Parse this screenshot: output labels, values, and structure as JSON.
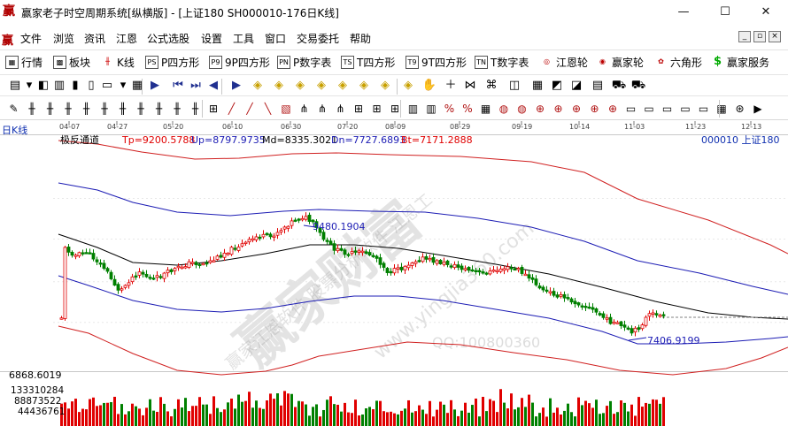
{
  "window": {
    "app_icon": "赢",
    "title": "赢家老子时空周期系统[纵横版] - [上证180  SH000010-176日K线]",
    "minimize": "—",
    "maximize": "☐",
    "close": "✕"
  },
  "menu": {
    "icon": "赢",
    "items": [
      "文件",
      "浏览",
      "资讯",
      "江恩",
      "公式选股",
      "设置",
      "工具",
      "窗口",
      "交易委托",
      "帮助"
    ],
    "mdi": [
      "_",
      "▫",
      "×"
    ]
  },
  "toolbar1": [
    {
      "icon": "grid-icon",
      "glyph": "▦",
      "label": "行情"
    },
    {
      "icon": "blocks-icon",
      "glyph": "▩",
      "label": "板块"
    },
    {
      "icon": "kline-icon",
      "glyph": "╫",
      "label": "K线"
    },
    {
      "icon": "ps-icon",
      "glyph": "PS",
      "label": "P四方形"
    },
    {
      "icon": "ps9-icon",
      "glyph": "P9",
      "label": "9P四方形"
    },
    {
      "icon": "pn-icon",
      "glyph": "PN",
      "label": "P数字表"
    },
    {
      "icon": "ts-icon",
      "glyph": "TS",
      "label": "T四方形"
    },
    {
      "icon": "ts9-icon",
      "glyph": "T9",
      "label": "9T四方形"
    },
    {
      "icon": "tn-icon",
      "glyph": "TN",
      "label": "T数字表"
    },
    {
      "icon": "gann-wheel-icon",
      "glyph": "◎",
      "label": "江恩轮"
    },
    {
      "icon": "winner-wheel-icon",
      "glyph": "◉",
      "label": "赢家轮"
    },
    {
      "icon": "hexagon-icon",
      "glyph": "✿",
      "label": "六角形"
    },
    {
      "icon": "dollar-icon",
      "glyph": "$",
      "label": "赢家服务"
    }
  ],
  "toolbar2": [
    "▤",
    "▾",
    "◧",
    "▥",
    "▮",
    "▯",
    "▭",
    "▾",
    "▦",
    "▶",
    "⏮",
    "⏭",
    "◀",
    "▶",
    "◈",
    "◈",
    "◈",
    "◈",
    "◈",
    "◈",
    "◈",
    "◈",
    "✋",
    "＋",
    "⋈",
    "⌘",
    "◫",
    "▦",
    "◩",
    "◪",
    "▤",
    "⛟",
    "⛟"
  ],
  "toolbar3": [
    "✎",
    "╫",
    "╫",
    "╫",
    "╫",
    "╫",
    "╫",
    "╫",
    "╫",
    "╫",
    "╫",
    "⊞",
    "╱",
    "╱",
    "╲",
    "▧",
    "⋔",
    "⋔",
    "⋔",
    "⊞",
    "⊞",
    "⊞",
    "▥",
    "▥",
    "%",
    "%",
    "▦",
    "◍",
    "◍",
    "⊕",
    "⊕",
    "⊕",
    "⊕",
    "⊕",
    "▭",
    "▭",
    "▭",
    "▭",
    "▭",
    "▦",
    "⊛",
    "▶"
  ],
  "chart": {
    "period": "日K线",
    "indicator": "极反通道",
    "tp": "Tp=9200.5788",
    "up": "Up=8797.9735",
    "md": "Md=8335.3021",
    "dn": "Dn=7727.6893",
    "bt": "Bt=7171.2888",
    "symbol": "000010  上证180",
    "date_ticks": [
      "04-07",
      "04-27",
      "05-20",
      "06-10",
      "06-30",
      "07-20",
      "08-09",
      "08-29",
      "09-19",
      "10-14",
      "11-03",
      "11-23",
      "12-13"
    ],
    "high_label": "9480.1904",
    "low_label": "7406.9199",
    "price_axis_label": "6868.6019",
    "volume_labels": [
      "133310284",
      "88873522",
      "44436761"
    ],
    "watermarks": [
      "赢家财富",
      "赢家江恩软件 股票分析软件 江恩工",
      "www.yingjia360.com",
      "QQ:100800360"
    ],
    "colors": {
      "up": "#e00000",
      "down": "#008000",
      "channel_outer": "#d02020",
      "channel_inner": "#1c1cb4",
      "midline": "#000000"
    }
  }
}
